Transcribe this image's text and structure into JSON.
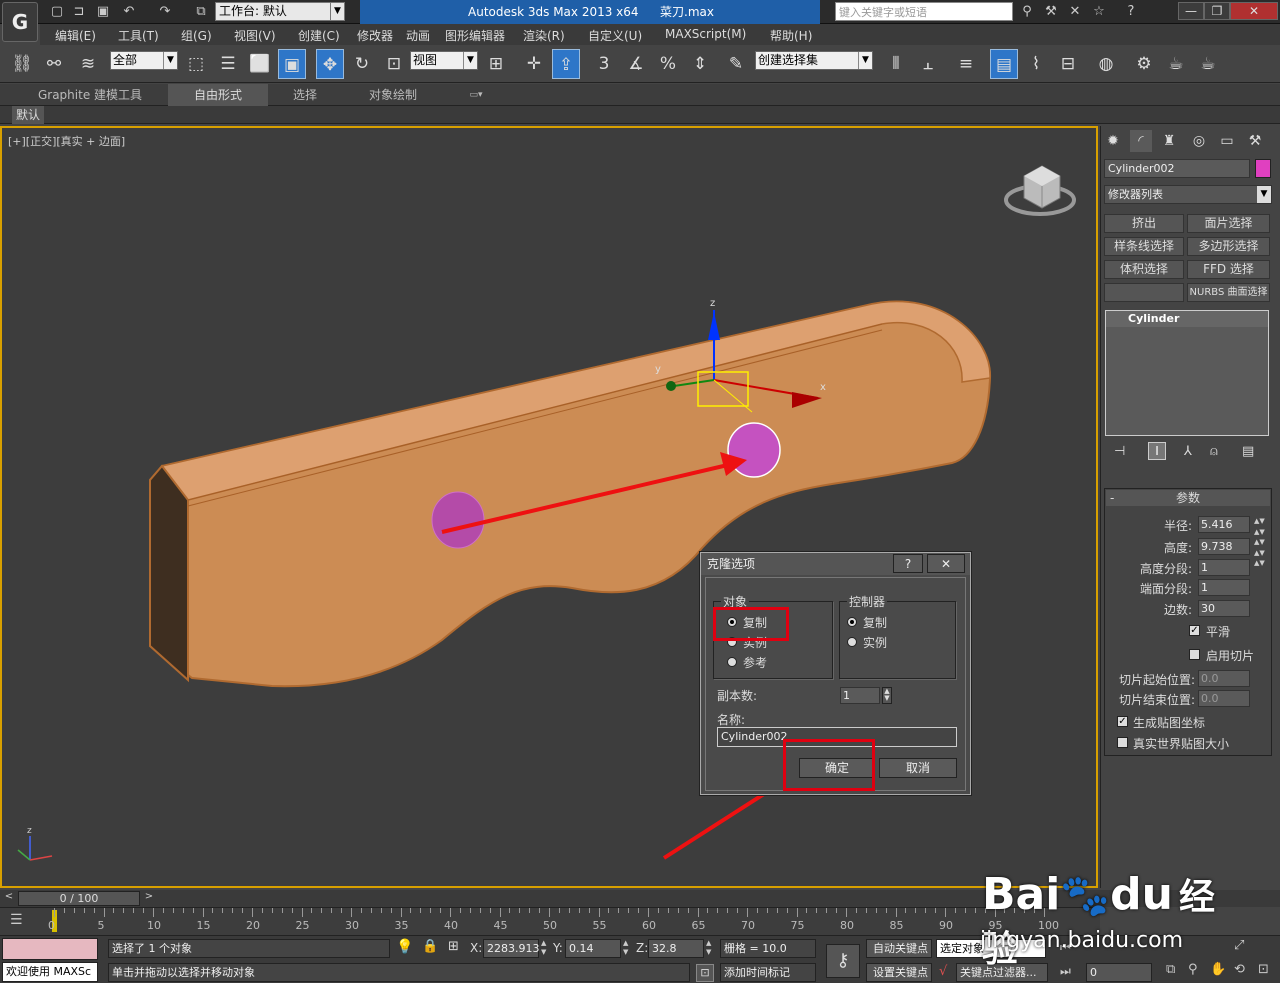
{
  "titlebar": {
    "logo": "G",
    "workspace": "工作台: 默认",
    "app": "Autodesk 3ds Max  2013 x64",
    "file": "菜刀.max",
    "search_placeholder": "键入关键字或短语"
  },
  "menus": [
    "编辑(E)",
    "工具(T)",
    "组(G)",
    "视图(V)",
    "创建(C)",
    "修改器",
    "动画",
    "图形编辑器",
    "渲染(R)",
    "自定义(U)",
    "MAXScript(M)",
    "帮助(H)"
  ],
  "toolbar": {
    "filter": "全部",
    "refcoord": "视图",
    "selset": "创建选择集",
    "snap3": "3",
    "snap_pct": "%"
  },
  "ribbon": {
    "tabs": [
      "Graphite 建模工具",
      "自由形式",
      "选择",
      "对象绘制"
    ],
    "sub": "默认"
  },
  "viewport": {
    "label": "[+][正交][真实 + 边面]"
  },
  "panel": {
    "object_name": "Cylinder002",
    "object_color": "#e040c0",
    "modifier_list": "修改器列表",
    "buttons": [
      "挤出",
      "面片选择",
      "样条线选择",
      "多边形选择",
      "体积选择",
      "FFD 选择",
      "",
      "NURBS 曲面选择"
    ],
    "stack_item": "Cylinder",
    "rollout_title": "参数",
    "params": [
      {
        "label": "半径:",
        "value": "5.416"
      },
      {
        "label": "高度:",
        "value": "9.738"
      },
      {
        "label": "高度分段:",
        "value": "1"
      },
      {
        "label": "端面分段:",
        "value": "1"
      },
      {
        "label": "边数:",
        "value": "30"
      }
    ],
    "smooth": "平滑",
    "slice_on": "启用切片",
    "slice_from": {
      "label": "切片起始位置:",
      "value": "0.0"
    },
    "slice_to": {
      "label": "切片结束位置:",
      "value": "0.0"
    },
    "gen_map": "生成贴图坐标",
    "real_world": "真实世界贴图大小"
  },
  "dialog": {
    "title": "克隆选项",
    "help": "?",
    "close": "✕",
    "object_group": "对象",
    "controller_group": "控制器",
    "obj_options": [
      "复制",
      "实例",
      "参考"
    ],
    "ctrl_options": [
      "复制",
      "实例"
    ],
    "copies_label": "副本数:",
    "copies_value": "1",
    "name_label": "名称:",
    "name_value": "Cylinder002",
    "ok": "确定",
    "cancel": "取消"
  },
  "timeline": {
    "frame": "0 / 100",
    "ticks": [
      "0",
      "5",
      "10",
      "15",
      "20",
      "25",
      "30",
      "35",
      "40",
      "45",
      "50",
      "55",
      "60",
      "65",
      "70",
      "75",
      "80",
      "85",
      "90",
      "95",
      "100"
    ]
  },
  "status": {
    "selected": "选择了 1 个对象",
    "hint": "单击并拖动以选择并移动对象",
    "welcome": "欢迎使用 MAXSc",
    "x": "2283.913",
    "y": "0.14",
    "z": "32.8",
    "grid": "栅格 = 10.0",
    "autokey": "自动关键点",
    "setkey": "设置关键点",
    "sel_obj": "选定对象",
    "key_filter": "关键点过滤器...",
    "add_time_tag": "添加时间标记",
    "frame_field": "0",
    "lbl_x": "X:",
    "lbl_y": "Y:",
    "lbl_z": "Z:"
  },
  "watermark": {
    "brand": "Bai",
    "brand2": "du",
    "jingyan": "经验",
    "url": "jingyan.baidu.com"
  },
  "gizmo": {
    "x": "x",
    "y": "y",
    "z": "z"
  },
  "axis_mini": {
    "z": "z"
  }
}
